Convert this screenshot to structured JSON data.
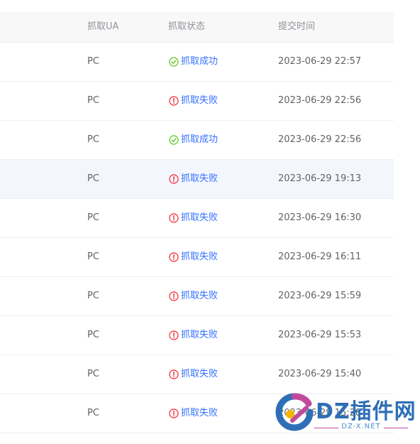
{
  "table": {
    "columns": [
      "抓取UA",
      "抓取状态",
      "提交时间"
    ],
    "rows": [
      {
        "ua": "PC",
        "status": "抓取成功",
        "ok": true,
        "time": "2023-06-29 22:57"
      },
      {
        "ua": "PC",
        "status": "抓取失败",
        "ok": false,
        "time": "2023-06-29 22:56"
      },
      {
        "ua": "PC",
        "status": "抓取成功",
        "ok": true,
        "time": "2023-06-29 22:56"
      },
      {
        "ua": "PC",
        "status": "抓取失败",
        "ok": false,
        "time": "2023-06-29 19:13"
      },
      {
        "ua": "PC",
        "status": "抓取失败",
        "ok": false,
        "time": "2023-06-29 16:30"
      },
      {
        "ua": "PC",
        "status": "抓取失败",
        "ok": false,
        "time": "2023-06-29 16:11"
      },
      {
        "ua": "PC",
        "status": "抓取失败",
        "ok": false,
        "time": "2023-06-29 15:59"
      },
      {
        "ua": "PC",
        "status": "抓取失败",
        "ok": false,
        "time": "2023-06-29 15:53"
      },
      {
        "ua": "PC",
        "status": "抓取失败",
        "ok": false,
        "time": "2023-06-29 15:40"
      },
      {
        "ua": "PC",
        "status": "抓取失败",
        "ok": false,
        "time": "2023-06-29 15:28"
      }
    ],
    "hover_row": 3
  },
  "colors": {
    "success": "#52c41a",
    "fail": "#f5222d",
    "link": "#3370ff",
    "hover_row": "#f3f7fd"
  },
  "icons": {
    "success": "check-circle-icon",
    "fail": "exclamation-circle-icon"
  },
  "watermark": {
    "title": "DZ插件网",
    "subtitle": "DZ-X.NET"
  }
}
